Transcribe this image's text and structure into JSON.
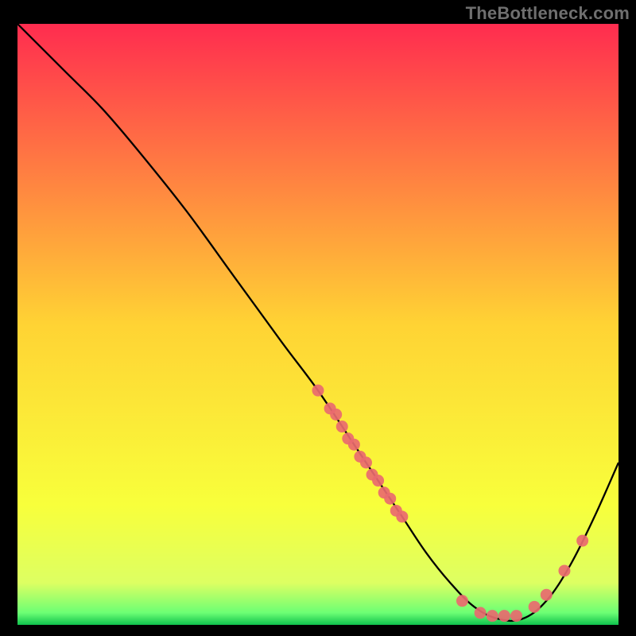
{
  "watermark": "TheBottleneck.com",
  "chart_data": {
    "type": "line",
    "title": "",
    "xlabel": "",
    "ylabel": "",
    "xlim": [
      0,
      100
    ],
    "ylim": [
      0,
      100
    ],
    "grid": false,
    "legend": false,
    "background_gradient": {
      "stops": [
        {
          "offset": 0.0,
          "color": "#ff2c4f"
        },
        {
          "offset": 0.5,
          "color": "#ffd334"
        },
        {
          "offset": 0.8,
          "color": "#f8ff3b"
        },
        {
          "offset": 0.93,
          "color": "#ddff62"
        },
        {
          "offset": 0.98,
          "color": "#6cff74"
        },
        {
          "offset": 1.0,
          "color": "#0fc24d"
        }
      ]
    },
    "series": [
      {
        "name": "curve",
        "x": [
          0,
          3,
          8,
          14,
          20,
          28,
          36,
          44,
          50,
          56,
          60,
          64,
          68,
          72,
          76,
          80,
          84,
          88,
          92,
          96,
          100
        ],
        "y": [
          100,
          97,
          92,
          86,
          79,
          69,
          58,
          47,
          39,
          30,
          24,
          18,
          12,
          7,
          3,
          1,
          1,
          4,
          10,
          18,
          27
        ]
      }
    ],
    "marker_clusters": [
      {
        "name": "upper-dense",
        "color": "#e96a6f",
        "points": [
          {
            "x": 50,
            "y": 39
          },
          {
            "x": 52,
            "y": 36
          },
          {
            "x": 53,
            "y": 35
          },
          {
            "x": 54,
            "y": 33
          },
          {
            "x": 55,
            "y": 31
          },
          {
            "x": 56,
            "y": 30
          },
          {
            "x": 57,
            "y": 28
          },
          {
            "x": 58,
            "y": 27
          },
          {
            "x": 59,
            "y": 25
          },
          {
            "x": 60,
            "y": 24
          },
          {
            "x": 61,
            "y": 22
          },
          {
            "x": 62,
            "y": 21
          },
          {
            "x": 63,
            "y": 19
          },
          {
            "x": 64,
            "y": 18
          }
        ]
      },
      {
        "name": "valley",
        "color": "#e96a6f",
        "points": [
          {
            "x": 74,
            "y": 4
          },
          {
            "x": 77,
            "y": 2
          },
          {
            "x": 79,
            "y": 1.5
          },
          {
            "x": 81,
            "y": 1.5
          },
          {
            "x": 83,
            "y": 1.5
          },
          {
            "x": 86,
            "y": 3
          },
          {
            "x": 88,
            "y": 5
          }
        ]
      },
      {
        "name": "right-sparse",
        "color": "#e96a6f",
        "points": [
          {
            "x": 91,
            "y": 9
          },
          {
            "x": 94,
            "y": 14
          }
        ]
      }
    ]
  }
}
